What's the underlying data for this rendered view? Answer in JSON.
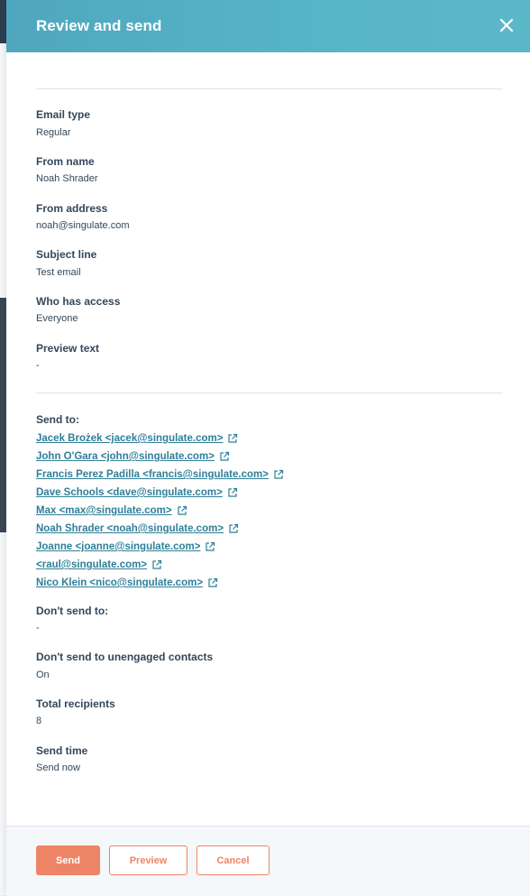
{
  "panel": {
    "title": "Review and send"
  },
  "fields": [
    {
      "label": "Email type",
      "value": "Regular"
    },
    {
      "label": "From name",
      "value": "Noah Shrader"
    },
    {
      "label": "From address",
      "value": "noah@singulate.com"
    },
    {
      "label": "Subject line",
      "value": "Test email"
    },
    {
      "label": "Who has access",
      "value": "Everyone"
    },
    {
      "label": "Preview text",
      "value": "-"
    }
  ],
  "send_to": {
    "label": "Send to:",
    "recipients": [
      "Jacek Brożek <jacek@singulate.com>",
      "John O'Gara <john@singulate.com>",
      "Francis Perez Padilla <francis@singulate.com>",
      "Dave Schools <dave@singulate.com>",
      "Max <max@singulate.com>",
      "Noah Shrader <noah@singulate.com>",
      "Joanne <joanne@singulate.com>",
      "<raul@singulate.com>",
      "Nico Klein <nico@singulate.com>"
    ]
  },
  "more_fields": [
    {
      "label": "Don't send to:",
      "value": "-"
    },
    {
      "label": "Don't send to unengaged contacts",
      "value": "On"
    },
    {
      "label": "Total recipients",
      "value": "8"
    },
    {
      "label": "Send time",
      "value": "Send now"
    }
  ],
  "footer": {
    "send_label": "Send",
    "preview_label": "Preview",
    "cancel_label": "Cancel"
  },
  "colors": {
    "header": "#57b5c8",
    "accent": "#ee8466",
    "link": "#2f7f98",
    "text": "#33475b"
  }
}
